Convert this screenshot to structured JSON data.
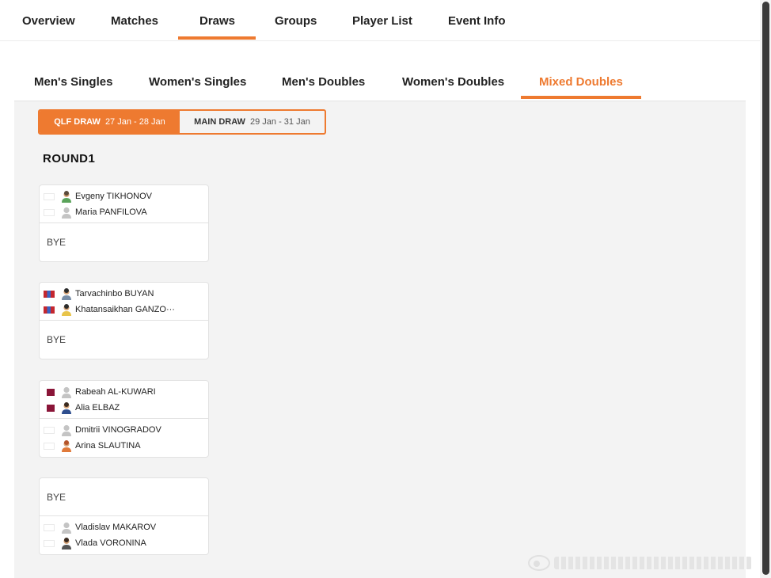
{
  "top_tabs": {
    "overview": "Overview",
    "matches": "Matches",
    "draws": "Draws",
    "groups": "Groups",
    "player_list": "Player List",
    "event_info": "Event Info"
  },
  "event_tabs": {
    "mens_singles": "Men's Singles",
    "womens_singles": "Women's Singles",
    "mens_doubles": "Men's Doubles",
    "womens_doubles": "Women's Doubles",
    "mixed_doubles": "Mixed Doubles"
  },
  "draw_toggle": {
    "qlf_label": "QLF DRAW",
    "qlf_dates": "27 Jan - 28 Jan",
    "main_label": "MAIN DRAW",
    "main_dates": "29 Jan - 31 Jan"
  },
  "round_title": "ROUND1",
  "bye_label": "BYE",
  "matches": [
    {
      "top": [
        {
          "name": "Evgeny TIKHONOV",
          "flag": "blank-flag"
        },
        {
          "name": "Maria PANFILOVA",
          "flag": "blank-flag"
        }
      ]
    },
    {
      "top": [
        {
          "name": "Tarvachinbo BUYAN",
          "flag": "mongolia-flag"
        },
        {
          "name": "Khatansaikhan GANZO···",
          "flag": "mongolia-flag"
        }
      ]
    },
    {
      "top": [
        {
          "name": "Rabeah AL-KUWARI",
          "flag": "qatar-flag"
        },
        {
          "name": "Alia ELBAZ",
          "flag": "qatar-flag"
        }
      ],
      "bottom": [
        {
          "name": "Dmitrii VINOGRADOV",
          "flag": "blank-flag"
        },
        {
          "name": "Arina SLAUTINA",
          "flag": "blank-flag"
        }
      ]
    },
    {
      "bottom": [
        {
          "name": "Vladislav MAKAROV",
          "flag": "blank-flag"
        },
        {
          "name": "Vlada VORONINA",
          "flag": "blank-flag"
        }
      ]
    }
  ],
  "colors": {
    "accent": "#ee7a30",
    "panel_background": "#f3f3f3"
  }
}
